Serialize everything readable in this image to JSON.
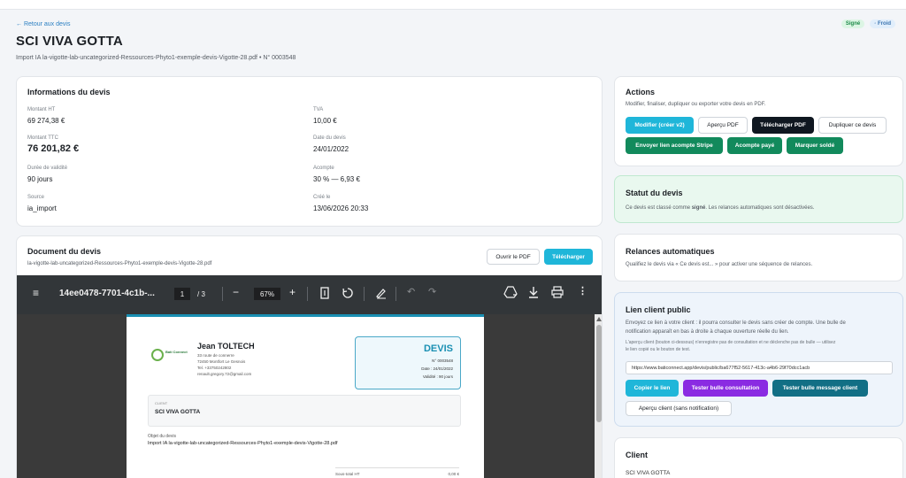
{
  "header": {
    "back_link": "← Retour aux devis",
    "title": "SCI VIVA GOTTA",
    "subtitle": "Import IA la-vigotte-lab-uncategorized-Ressources-Phyto1-exemple-devis-Vigotte-28.pdf • N° 0003548",
    "badges": [
      "Signé",
      "Froid"
    ]
  },
  "info": {
    "title": "Informations du devis",
    "fields": [
      {
        "label": "Montant HT",
        "value": "69 274,38 €"
      },
      {
        "label": "TVA",
        "value": "10,00 €"
      },
      {
        "label": "Montant TTC",
        "value": "76 201,82 €"
      },
      {
        "label": "Date du devis",
        "value": "24/01/2022"
      },
      {
        "label": "Durée de validité",
        "value": "90 jours"
      },
      {
        "label": "Acompte",
        "value": "30 % — 6,93 €"
      },
      {
        "label": "Source",
        "value": "ia_import"
      },
      {
        "label": "Créé le",
        "value": "13/06/2026 20:33"
      }
    ]
  },
  "document": {
    "title": "Document du devis",
    "filename": "la-vigotte-lab-uncategorized-Ressources-Phyto1-exemple-devis-Vigotte-28.pdf",
    "open_label": "Ouvrir le PDF",
    "download_label": "Télécharger",
    "viewer": {
      "file_label": "14ee0478-7701-4c1b-...",
      "page": "1",
      "pages": "/ 3",
      "zoom": "67%"
    },
    "pdf": {
      "logo_text": "Bati Connect",
      "issuer": "Jean TOLTECH",
      "address_lines": [
        "33 route de connerre",
        "72450 Montfort Le Gesnois",
        "Tel. +33750242802",
        "renault.gregory.72@gmail.com"
      ],
      "devis_title": "DEVIS",
      "devis_number": "N° 0003548",
      "devis_date": "Date : 24/01/2022",
      "devis_validity": "Validité : 90 jours",
      "client_label": "CLIENT",
      "client_name": "SCI VIVA GOTTA",
      "object_label": "Objet du devis",
      "object": "Import IA la-vigotte-lab-uncategorized-Ressources-Phyto1-exemple-devis-Vigotte-28.pdf",
      "subtotal_label": "Sous-total HT",
      "subtotal_value": "0,00 €"
    }
  },
  "actions": {
    "title": "Actions",
    "desc": "Modifier, finaliser, dupliquer ou exporter votre devis en PDF.",
    "buttons": {
      "edit": "Modifier (créer v2)",
      "preview": "Aperçu PDF",
      "download": "Télécharger PDF",
      "duplicate": "Dupliquer ce devis",
      "stripe": "Envoyer lien acompte Stripe",
      "paid": "Acompte payé",
      "settled": "Marquer soldé"
    }
  },
  "status": {
    "title": "Statut du devis",
    "desc_pre": "Ce devis est classé comme ",
    "desc_bold": "signé",
    "desc_post": ". Les relances automatiques sont désactivées."
  },
  "relances": {
    "title": "Relances automatiques",
    "desc": "Qualifiez le devis via « Ce devis est... » pour activer une séquence de relances."
  },
  "lien": {
    "title": "Lien client public",
    "desc1": "Envoyez ce lien à votre client : il pourra consulter le devis sans créer de compte. Une bulle de",
    "desc2": "notification apparaît en bas à droite à chaque ouverture réelle du lien.",
    "note1": "L'aperçu client (bouton ci-dessous) n'enregistre pas de consultation et ne déclenche pas de bulle — utilisez",
    "note2": "le lien copié ou le bouton de test.",
    "url": "https://www.baticonnect.app/devis/public/ba677f52-5617-413c-a4b6-29f70dcc1acb",
    "copy": "Copier le lien",
    "test_consult": "Tester bulle consultation",
    "test_message": "Tester bulle message client",
    "preview": "Aperçu client (sans notification)"
  },
  "client": {
    "title": "Client",
    "name": "SCI VIVA GOTTA"
  }
}
